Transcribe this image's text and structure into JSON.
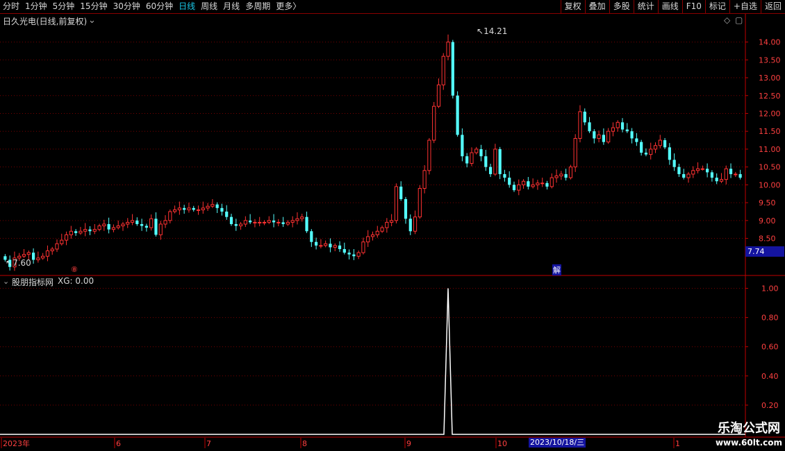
{
  "toolbar": {
    "periods": [
      "分时",
      "1分钟",
      "5分钟",
      "15分钟",
      "30分钟",
      "60分钟",
      "日线",
      "周线",
      "月线",
      "多周期",
      "更多"
    ],
    "active_period": "日线",
    "more_arrow": "〉",
    "buttons": [
      "复权",
      "叠加",
      "多股",
      "统计",
      "画线",
      "F10",
      "标记",
      "+自选",
      "返回"
    ]
  },
  "main_panel": {
    "title": "日久光电(日线,前复权)",
    "current_price_tag": "7.74",
    "high_label": "14.21",
    "low_label": "7.60",
    "event_markers": [
      "⑧",
      "解"
    ],
    "y_ticks": [
      "14.00",
      "13.50",
      "13.00",
      "12.50",
      "12.00",
      "11.50",
      "11.00",
      "10.50",
      "10.00",
      "9.50",
      "9.00",
      "8.50"
    ]
  },
  "indicator_panel": {
    "title": "股朋指标网",
    "value_label": "XG: 0.00",
    "y_ticks": [
      "1.00",
      "0.80",
      "0.60",
      "0.40",
      "0.20"
    ]
  },
  "time_axis": {
    "labels": [
      "2023年",
      "6",
      "7",
      "8",
      "9",
      "10",
      "1"
    ],
    "crosshair_date": "2023/10/18/三"
  },
  "watermark": {
    "line1": "乐淘公式网",
    "line2": "www.60lt.com"
  },
  "colors": {
    "up": "#ff3232",
    "down": "#54ffff",
    "grid": "#7a0000",
    "axis": "#c00000",
    "signal": "#ffffff",
    "highlight": "#1414a0"
  },
  "chart_data": {
    "type": "candlestick",
    "y_range": [
      7.5,
      14.4
    ],
    "indicator_range": [
      0,
      1.05
    ],
    "high": 14.21,
    "low": 7.6,
    "last": 7.74,
    "closes": [
      7.9,
      7.7,
      7.95,
      8.0,
      8.05,
      8.1,
      7.9,
      7.95,
      8.0,
      8.15,
      8.2,
      8.35,
      8.45,
      8.6,
      8.7,
      8.65,
      8.7,
      8.75,
      8.7,
      8.75,
      8.85,
      8.9,
      8.75,
      8.8,
      8.85,
      8.9,
      8.95,
      9.0,
      8.9,
      8.85,
      8.8,
      9.05,
      8.6,
      8.9,
      9.0,
      9.25,
      9.3,
      9.35,
      9.3,
      9.35,
      9.3,
      9.3,
      9.35,
      9.4,
      9.45,
      9.35,
      9.25,
      9.1,
      8.9,
      8.85,
      8.9,
      9.0,
      8.95,
      8.95,
      8.95,
      8.95,
      9.0,
      8.95,
      8.95,
      8.9,
      8.95,
      9.0,
      9.05,
      9.1,
      8.7,
      8.4,
      8.3,
      8.3,
      8.35,
      8.25,
      8.3,
      8.2,
      8.1,
      8.05,
      8.0,
      8.1,
      8.4,
      8.55,
      8.6,
      8.7,
      8.8,
      8.95,
      9.0,
      9.95,
      9.6,
      9.05,
      8.7,
      9.1,
      9.9,
      10.4,
      11.25,
      12.2,
      12.8,
      13.6,
      14.0,
      12.5,
      11.4,
      10.8,
      10.6,
      10.9,
      11.0,
      10.8,
      10.5,
      10.3,
      11.0,
      10.3,
      10.2,
      10.0,
      9.85,
      10.0,
      10.1,
      9.95,
      10.0,
      10.05,
      10.05,
      9.95,
      10.2,
      10.25,
      10.3,
      10.2,
      10.5,
      11.3,
      12.05,
      11.75,
      11.5,
      11.3,
      11.4,
      11.2,
      11.5,
      11.6,
      11.75,
      11.55,
      11.5,
      11.3,
      11.2,
      10.9,
      10.85,
      11.0,
      11.1,
      11.25,
      11.05,
      10.7,
      10.5,
      10.3,
      10.2,
      10.3,
      10.4,
      10.45,
      10.45,
      10.35,
      10.2,
      10.1,
      10.15,
      10.45,
      10.3,
      10.3,
      10.2
    ]
  }
}
